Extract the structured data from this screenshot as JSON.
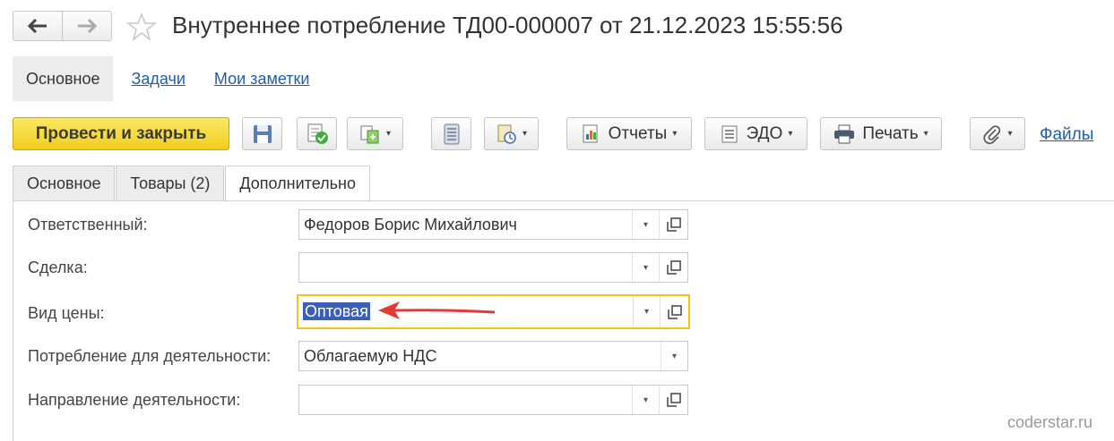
{
  "window": {
    "title": "Внутреннее потребление ТД00-000007 от 21.12.2023 15:55:56"
  },
  "icons": {
    "back": "arrow-left-icon",
    "forward": "arrow-right-icon",
    "favorite": "star-icon",
    "save": "floppy-disk-icon",
    "post": "post-document-icon",
    "create_based": "create-based-on-icon",
    "list": "list-icon",
    "document_structure": "document-clock-icon",
    "reports": "reports-icon",
    "edo": "edo-icon",
    "print": "printer-icon",
    "attach": "paperclip-icon"
  },
  "subnav": {
    "main": "Основное",
    "tasks": "Задачи",
    "notes": "Мои заметки"
  },
  "toolbar": {
    "post_close": "Провести и закрыть",
    "reports": "Отчеты",
    "edo": "ЭДО",
    "print": "Печать",
    "files": "Файлы",
    "dropdown_glyph": "▾"
  },
  "tabs": [
    "Основное",
    "Товары (2)",
    "Дополнительно"
  ],
  "form": {
    "responsible": {
      "label": "Ответственный:",
      "value": "Федоров Борис Михайлович"
    },
    "deal": {
      "label": "Сделка:",
      "value": ""
    },
    "price_type": {
      "label": "Вид цены:",
      "value": "Оптовая"
    },
    "consumption": {
      "label": "Потребление для деятельности:",
      "value": "Облагаемую НДС"
    },
    "direction": {
      "label": "Направление деятельности:",
      "value": ""
    }
  },
  "watermark": "coderstar.ru",
  "colors": {
    "primary_button": "#f6dc3c",
    "link": "#1f5fa8",
    "focus_border": "#f0c419",
    "selection": "#3b5fb5",
    "annotation_arrow": "#e53935"
  }
}
